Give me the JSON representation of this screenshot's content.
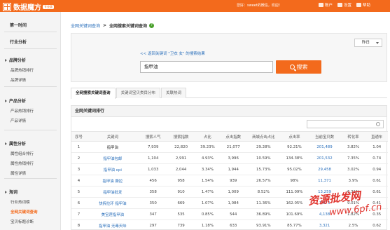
{
  "topbar": {
    "logo_text": "数据魔方",
    "logo_badge": "专业版",
    "welcome": "您好：sweet的微信，欢迎！",
    "links": [
      {
        "label": "账户",
        "icon": "user-icon"
      },
      {
        "label": "设置",
        "icon": "gear-icon"
      },
      {
        "label": "帮助",
        "icon": "help-icon"
      }
    ]
  },
  "sidebar": {
    "groups": [
      {
        "head": "第一时间",
        "items": []
      },
      {
        "head": "行业分析",
        "items": []
      },
      {
        "head": "品牌分析",
        "items": [
          "品牌热销排行",
          "品牌详情"
        ]
      },
      {
        "head": "产品分析",
        "items": [
          "产品热销排行",
          "产品详情"
        ]
      },
      {
        "head": "属性分析",
        "items": [
          "属性组合排行",
          "属性热销排行",
          "属性详情"
        ]
      },
      {
        "head": "淘词",
        "items": [
          "行业热词榜",
          "全网关键词查询",
          "宝贝标题诊断"
        ]
      }
    ],
    "active_item": "全网关键词查询"
  },
  "breadcrumb": {
    "first": "全网关键词查询",
    "separator": ">",
    "second": "全网搜索关键词查询"
  },
  "search": {
    "date_select": "昨日",
    "back_link": "<< 返回关键词 \"卫衣 女\" 的搜索结果",
    "input_value": "指甲油",
    "button_label": "搜索"
  },
  "tabs": [
    "全网搜索关键词查询",
    "关键词宝贝类目分布",
    "关联热词"
  ],
  "rank": {
    "title": "全网关键词排行",
    "columns": [
      "序号",
      "关键词",
      "搜索人气",
      "搜索指数",
      "占比",
      "点击指数",
      "商城点击占比",
      "点击率",
      "当前宝贝数",
      "转化率",
      "直通车"
    ],
    "rows": [
      [
        "1",
        "指甲油",
        "7,939",
        "22,820",
        "39.23%",
        "21,077",
        "29.28%",
        "92.21%",
        "201,489",
        "3.82%",
        "1.04"
      ],
      [
        "2",
        "指甲油包邮",
        "1,104",
        "2,991",
        "4.93%",
        "3,996",
        "10.59%",
        "134.38%",
        "201,532",
        "7.35%",
        "0.74"
      ],
      [
        "3",
        "指甲油 opi",
        "1,033",
        "2,044",
        "3.34%",
        "1,944",
        "15.73%",
        "95.02%",
        "29,458",
        "3.02%",
        "0.94"
      ],
      [
        "4",
        "指甲油 撕拉",
        "456",
        "958",
        "1.54%",
        "939",
        "26.57%",
        "98%",
        "11,371",
        "3.9%",
        "0.61"
      ],
      [
        "5",
        "指甲油批发",
        "358",
        "910",
        "1.47%",
        "1,009",
        "8.52%",
        "111.09%",
        "13,259",
        "6.31%",
        "0.61"
      ],
      [
        "6",
        "快拆拉环 指甲油",
        "350",
        "669",
        "1.07%",
        "1,084",
        "11.36%",
        "162.05%",
        "1,073",
        "9.01%",
        "0.41"
      ],
      [
        "7",
        "美宝莲指甲油",
        "347",
        "535",
        "0.85%",
        "544",
        "36.89%",
        "101.69%",
        "4,138",
        "1.82%",
        "0.35"
      ],
      [
        "8",
        "指甲油 无毒天味",
        "297",
        "739",
        "1.18%",
        "633",
        "93.91%",
        "85.77%",
        "3,321",
        "2.5%",
        "0.62"
      ]
    ]
  },
  "watermark": {
    "line1": "资源批发网",
    "line2": "www.6pf.cn"
  },
  "colors": {
    "brand": "#f36a1c",
    "link": "#2a6fbb",
    "help_green": "#4aa02c"
  }
}
